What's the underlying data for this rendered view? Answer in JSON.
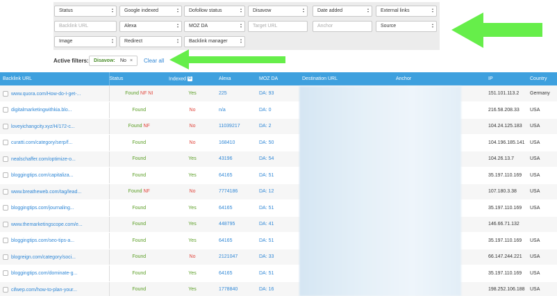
{
  "filters": {
    "row1": [
      {
        "label": "Status",
        "type": "select"
      },
      {
        "label": "Google indexed",
        "type": "select"
      },
      {
        "label": "Dofollow status",
        "type": "select"
      },
      {
        "label": "Disavow",
        "type": "select"
      },
      {
        "label": "Date added",
        "type": "select"
      },
      {
        "label": "External links",
        "type": "select"
      }
    ],
    "row2": [
      {
        "placeholder": "Backlink URL",
        "type": "input"
      },
      {
        "label": "Alexa",
        "type": "select"
      },
      {
        "label": "MOZ DA",
        "type": "select"
      },
      {
        "placeholder": "Target URL",
        "type": "input"
      },
      {
        "placeholder": "Anchor",
        "type": "input"
      },
      {
        "label": "Source",
        "type": "select"
      }
    ],
    "row3": [
      {
        "label": "Image",
        "type": "select"
      },
      {
        "label": "Redirect",
        "type": "select"
      },
      {
        "label": "Backlink manager",
        "type": "select"
      }
    ]
  },
  "active_filters": {
    "label": "Active filters:",
    "chip_name": "Disavow:",
    "chip_value": "No",
    "chip_close": "×",
    "clear_all": "Clear all"
  },
  "table": {
    "columns": [
      "Backlink URL",
      "Status",
      "Indexed",
      "Alexa",
      "MOZ DA",
      "Destination URL",
      "Anchor",
      "IP",
      "Country"
    ],
    "indexed_icon": "G",
    "rows": [
      {
        "url": "www.quora.com/How-do-I-get-...",
        "status": "Found",
        "flags": "NF NI",
        "indexed": "Yes",
        "alexa": "225",
        "da": "93",
        "ip": "151.101.113.2",
        "country": "Germany"
      },
      {
        "url": "digitalmarketingwithkia.blo...",
        "status": "Found",
        "flags": "",
        "indexed": "No",
        "alexa": "n/a",
        "da": "0",
        "ip": "216.58.208.33",
        "country": "USA"
      },
      {
        "url": "loveyichangcity.xyz/H/172-c...",
        "status": "Found",
        "flags": "NF",
        "indexed": "No",
        "alexa": "11039217",
        "da": "2",
        "ip": "104.24.125.183",
        "country": "USA"
      },
      {
        "url": "curatti.com/category/serp/f...",
        "status": "Found",
        "flags": "",
        "indexed": "No",
        "alexa": "168410",
        "da": "50",
        "ip": "104.196.185.141",
        "country": "USA"
      },
      {
        "url": "nealschaffer.com/optimize-o...",
        "status": "Found",
        "flags": "",
        "indexed": "Yes",
        "alexa": "43196",
        "da": "54",
        "ip": "104.26.13.7",
        "country": "USA"
      },
      {
        "url": "bloggingtips.com/capitaliza...",
        "status": "Found",
        "flags": "",
        "indexed": "Yes",
        "alexa": "64165",
        "da": "51",
        "ip": "35.197.110.169",
        "country": "USA"
      },
      {
        "url": "www.breatheweb.com/tag/lead...",
        "status": "Found",
        "flags": "NF",
        "indexed": "No",
        "alexa": "7774186",
        "da": "12",
        "ip": "107.180.3.38",
        "country": "USA"
      },
      {
        "url": "bloggingtips.com/journaling...",
        "status": "Found",
        "flags": "",
        "indexed": "Yes",
        "alexa": "64165",
        "da": "51",
        "ip": "35.197.110.169",
        "country": "USA"
      },
      {
        "url": "www.themarketingscope.com/e...",
        "status": "Found",
        "flags": "",
        "indexed": "Yes",
        "alexa": "448795",
        "da": "41",
        "ip": "146.66.71.132",
        "country": ""
      },
      {
        "url": "bloggingtips.com/seo-tips-a...",
        "status": "Found",
        "flags": "",
        "indexed": "Yes",
        "alexa": "64165",
        "da": "51",
        "ip": "35.197.110.169",
        "country": "USA"
      },
      {
        "url": "blogreign.com/category/soci...",
        "status": "Found",
        "flags": "",
        "indexed": "No",
        "alexa": "2121047",
        "da": "33",
        "ip": "66.147.244.221",
        "country": "USA"
      },
      {
        "url": "bloggingtips.com/dominate-g...",
        "status": "Found",
        "flags": "",
        "indexed": "Yes",
        "alexa": "64165",
        "da": "51",
        "ip": "35.197.110.169",
        "country": "USA"
      },
      {
        "url": "cifwep.com/how-to-plan-your...",
        "status": "Found",
        "flags": "",
        "indexed": "Yes",
        "alexa": "1778840",
        "da": "16",
        "ip": "198.252.106.188",
        "country": "USA"
      }
    ]
  },
  "colors": {
    "header_bg": "#3ea0de",
    "arrow": "#66ee4a",
    "link": "#2f87d6",
    "found": "#5a9e24",
    "no": "#e0453b"
  },
  "da_prefix": "DA: "
}
